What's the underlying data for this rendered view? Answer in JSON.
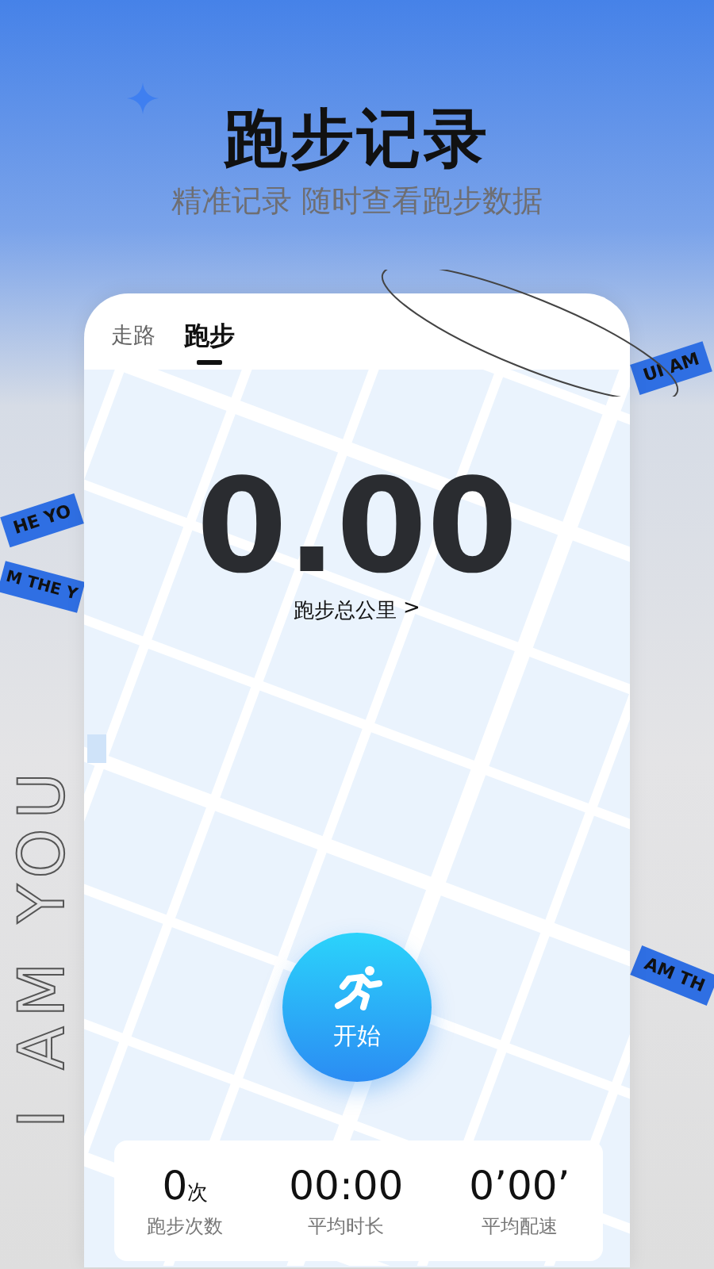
{
  "header": {
    "title": "跑步记录",
    "subtitle": "精准记录 随时查看跑步数据"
  },
  "decor": {
    "ribbons": [
      "UI AM",
      "HE YO",
      "M THE Y",
      "AM TH"
    ],
    "outline_text": "I AM YOU"
  },
  "tabs": [
    {
      "label": "走路",
      "selected": false
    },
    {
      "label": "跑步",
      "selected": true
    }
  ],
  "distance": {
    "value": "0.00",
    "label": "跑步总公里",
    "chevron": ">"
  },
  "start_button": {
    "label": "开始"
  },
  "stats": [
    {
      "value": "0",
      "unit": "次",
      "label": "跑步次数"
    },
    {
      "value": "00:00",
      "label": "平均时长"
    },
    {
      "value": "0’00’",
      "label": "平均配速"
    }
  ]
}
